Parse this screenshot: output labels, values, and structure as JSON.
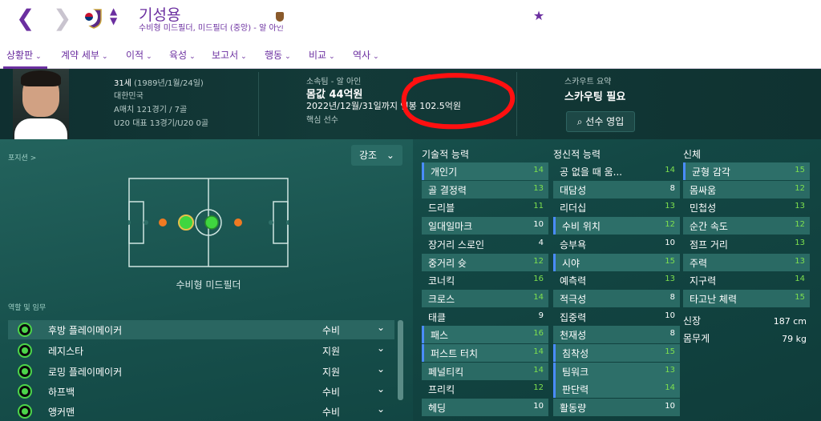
{
  "header": {
    "name": "기성용",
    "subtitle": "수비형 미드필더, 미드필더 (중앙) - 알 아인"
  },
  "menu": [
    {
      "label": "상황판"
    },
    {
      "label": "계약 세부"
    },
    {
      "label": "이적"
    },
    {
      "label": "육성"
    },
    {
      "label": "보고서"
    },
    {
      "label": "행동"
    },
    {
      "label": "비교"
    },
    {
      "label": "역사"
    }
  ],
  "info": {
    "age": "31세",
    "dob": "(1989년/1월/24일)",
    "nation": "대한민국",
    "caps": "A매치 121경기 / 7골",
    "u20": "U20 대표 13경기/U20 0골",
    "club": "소속팀 - 알 아인",
    "value": "몸값 44억원",
    "contract": "2022년/12월/31일까지 연봉 102.5억원",
    "status": "핵심 선수",
    "scout_title": "스카우트 요약",
    "scout_value": "스카우팅 필요",
    "scout_button": "선수 영입"
  },
  "position": {
    "title": "포지션 >",
    "emphasis": "강조",
    "label": "수비형 미드필더"
  },
  "roles": {
    "title": "역할 및 임무",
    "items": [
      {
        "name": "후방 플레이메이커",
        "duty": "수비"
      },
      {
        "name": "레지스타",
        "duty": "지원"
      },
      {
        "name": "로밍 플레이메이커",
        "duty": "지원"
      },
      {
        "name": "하프백",
        "duty": "수비"
      },
      {
        "name": "앵커맨",
        "duty": "수비"
      }
    ]
  },
  "attributes": {
    "technical_title": "기술적 능력",
    "technical": [
      {
        "name": "개인기",
        "value": "14"
      },
      {
        "name": "골 결정력",
        "value": "13"
      },
      {
        "name": "드리블",
        "value": "11"
      },
      {
        "name": "일대일마크",
        "value": "10"
      },
      {
        "name": "장거리 스로인",
        "value": "4"
      },
      {
        "name": "중거리 슛",
        "value": "12"
      },
      {
        "name": "코너킥",
        "value": "16"
      },
      {
        "name": "크로스",
        "value": "14"
      },
      {
        "name": "태클",
        "value": "9"
      },
      {
        "name": "패스",
        "value": "16"
      },
      {
        "name": "퍼스트 터치",
        "value": "14"
      },
      {
        "name": "페널티킥",
        "value": "14"
      },
      {
        "name": "프리킥",
        "value": "12"
      },
      {
        "name": "헤딩",
        "value": "10"
      }
    ],
    "mental_title": "정신적 능력",
    "mental": [
      {
        "name": "공 없을 때 움...",
        "value": "14"
      },
      {
        "name": "대담성",
        "value": "8"
      },
      {
        "name": "리더십",
        "value": "13"
      },
      {
        "name": "수비 위치",
        "value": "12"
      },
      {
        "name": "승부욕",
        "value": "10"
      },
      {
        "name": "시야",
        "value": "15"
      },
      {
        "name": "예측력",
        "value": "13"
      },
      {
        "name": "적극성",
        "value": "8"
      },
      {
        "name": "집중력",
        "value": "10"
      },
      {
        "name": "천재성",
        "value": "8"
      },
      {
        "name": "침착성",
        "value": "15"
      },
      {
        "name": "팀워크",
        "value": "13"
      },
      {
        "name": "판단력",
        "value": "14"
      },
      {
        "name": "활동량",
        "value": "10"
      }
    ],
    "physical_title": "신체",
    "physical": [
      {
        "name": "균형 감각",
        "value": "15"
      },
      {
        "name": "몸싸움",
        "value": "12"
      },
      {
        "name": "민첩성",
        "value": "13"
      },
      {
        "name": "순간 속도",
        "value": "12"
      },
      {
        "name": "점프 거리",
        "value": "13"
      },
      {
        "name": "주력",
        "value": "13"
      },
      {
        "name": "지구력",
        "value": "14"
      },
      {
        "name": "타고난 체력",
        "value": "15"
      }
    ],
    "height_label": "신장",
    "height_value": "187 cm",
    "weight_label": "몸무게",
    "weight_value": "79 kg"
  },
  "colors": {
    "accent": "#6b2fa0",
    "value_green": "#7ee04e",
    "value_white": "#ffffff"
  }
}
